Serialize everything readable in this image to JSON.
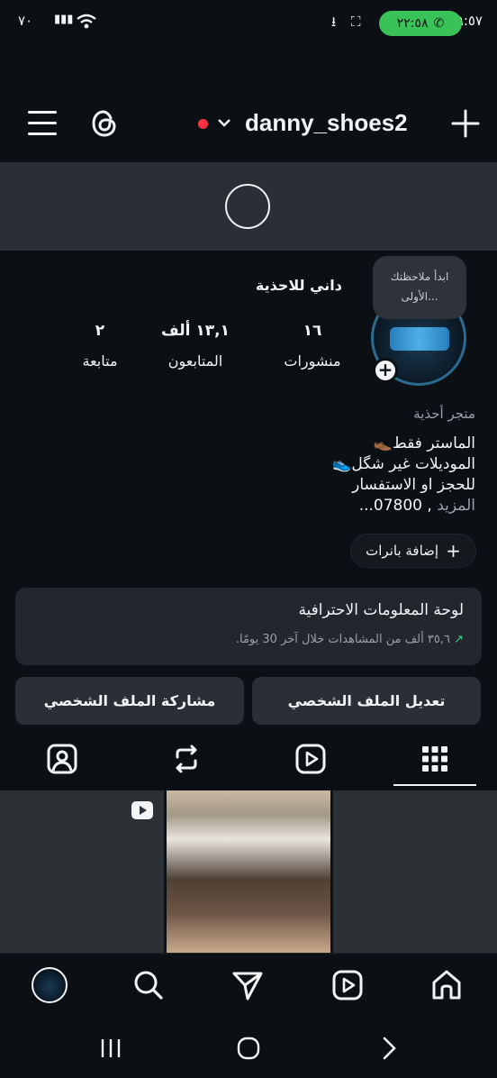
{
  "status_bar": {
    "time": "٩:٥٧",
    "call_timer": "٢٢:٥٨",
    "battery": "٧٠"
  },
  "header": {
    "username": "danny_shoes2"
  },
  "profile": {
    "display_name": "داني للاحذية",
    "note_text": "ابدأ ملاحظتك الأولى...",
    "stats": [
      {
        "value": "١٦",
        "label": "منشورات"
      },
      {
        "value": "١٣,١ ألف",
        "label": "المتابعون"
      },
      {
        "value": "٢",
        "label": "متابعة"
      }
    ],
    "category": "متجر أحذية",
    "bio_lines": [
      "الماستر فقط👞",
      "الموديلات  غير شگل👟",
      "للحجز او الاستفسار",
      ", 07800..."
    ],
    "bio_more": "المزيد",
    "add_banners": "إضافة بانرات"
  },
  "dashboard": {
    "title": "لوحة المعلومات الاحترافية",
    "subtitle": "٣٥,٦ ألف من المشاهدات خلال آخر 30 يومًا."
  },
  "buttons": {
    "edit_profile": "تعديل الملف الشخصي",
    "share_profile": "مشاركة الملف الشخصي"
  },
  "colors": {
    "background": "#0b1014",
    "surface": "#2a2f35",
    "call_green": "#38c257",
    "live_red": "#ff3040",
    "trend_green": "#3fcf8e"
  }
}
